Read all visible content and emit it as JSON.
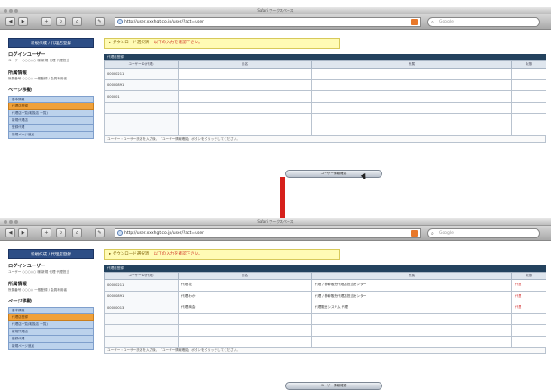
{
  "window_title": "Safari ワークスペース",
  "url": "http://user.xxxhgt.co.jp/user/?act=user",
  "search_placeholder": "Google",
  "toolbar_buttons": [
    "◀",
    "▶",
    "+",
    "↻",
    "⌂",
    "✎"
  ],
  "sidebar": {
    "header": "新規作成 / 代理店登録",
    "login_title": "ログインユーザー",
    "login_text": "ユーザー ○○○○○ 様 新規 代理 代理担当",
    "company_title": "所属情報",
    "company_text": "所属番号 ○○○○ 一般登録 / 会員利用者",
    "menu_title": "ページ移動",
    "menu": [
      "基本情報",
      "代理店登録",
      "代理店一覧(取扱店 一覧)",
      "新規代理店",
      "登録代理",
      "新規ページ追加"
    ],
    "active_index": 1
  },
  "notice": {
    "label": "▸ ダウンロード選択済",
    "link": "以下の入力を確認下さい。"
  },
  "table_header": "代理店登録",
  "columns": [
    "ユーザーID(代理)",
    "氏名",
    "所属",
    "状態"
  ],
  "rows_before": [
    [
      "00000211",
      "",
      "",
      ""
    ],
    [
      "00000891",
      "",
      "",
      ""
    ],
    [
      "000001",
      "",
      "",
      ""
    ],
    [
      "",
      "",
      "",
      ""
    ],
    [
      "",
      "",
      "",
      ""
    ],
    [
      "",
      "",
      "",
      ""
    ]
  ],
  "rows_after": [
    [
      "00000211",
      "代理 花",
      "代理 / 基幹販売代理店担当センター",
      "代理"
    ],
    [
      "00000891",
      "代理 わか",
      "代理 / 基幹販売代理店担当センター",
      "代理"
    ],
    [
      "00000013",
      "代理 商会",
      "代理販売システム 代理",
      "代理"
    ],
    [
      "",
      "",
      "",
      ""
    ],
    [
      "",
      "",
      "",
      ""
    ],
    [
      "",
      "",
      "",
      ""
    ]
  ],
  "footnote": "ユーザー・ユーザー氏名を入力後、「ユーザー情報確認」ボタンをクリックしてください。",
  "register_button": "ユーザー情報確認",
  "colors": {
    "sidebar_header": "#2d4e86",
    "table_header": "#23425e",
    "notice": "#fffbb5",
    "active_menu": "#f0a13a",
    "arrow": "#d6201b"
  }
}
